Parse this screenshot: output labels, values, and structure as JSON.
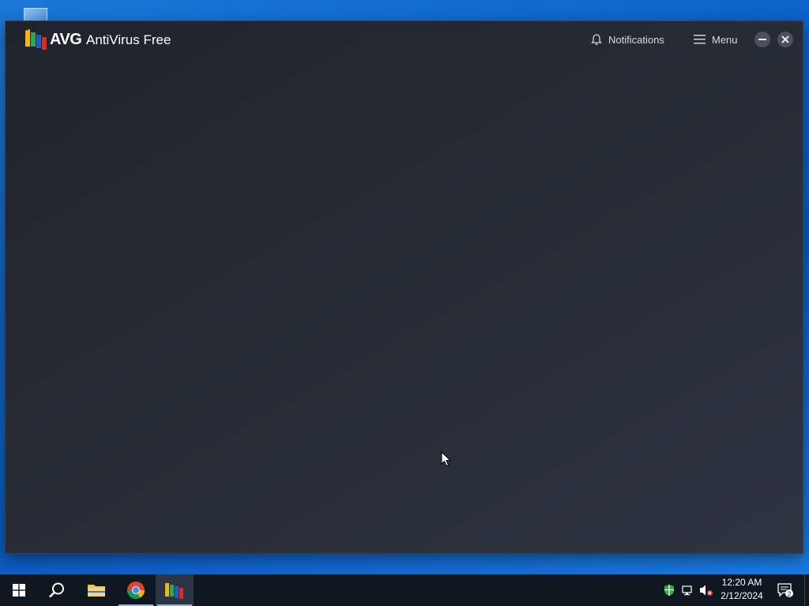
{
  "window": {
    "brand": "AVG",
    "product_name": "AntiVirus Free",
    "notifications_label": "Notifications",
    "menu_label": "Menu",
    "minimize_icon": "minimize-icon",
    "close_icon": "close-icon"
  },
  "taskbar": {
    "items": [
      {
        "name": "start-button",
        "icon": "windows-logo-icon"
      },
      {
        "name": "search-button",
        "icon": "search-icon"
      },
      {
        "name": "file-explorer",
        "icon": "folder-icon"
      },
      {
        "name": "chrome",
        "icon": "chrome-icon"
      },
      {
        "name": "avg-antivirus",
        "icon": "avg-icon",
        "active": true
      }
    ],
    "tray": {
      "icons": [
        "security-shield-icon",
        "network-icon",
        "volume-muted-icon"
      ],
      "time": "12:20 AM",
      "date": "2/12/2024",
      "notification_count": "2"
    }
  },
  "colors": {
    "desktop_blue": "#0b58bd",
    "window_bg": "#262b34",
    "taskbar": "#0f1720",
    "avg_red": "#e4281c",
    "avg_green": "#2ea84a",
    "avg_yellow": "#f5b70f",
    "avg_blue": "#1f5fbf"
  }
}
